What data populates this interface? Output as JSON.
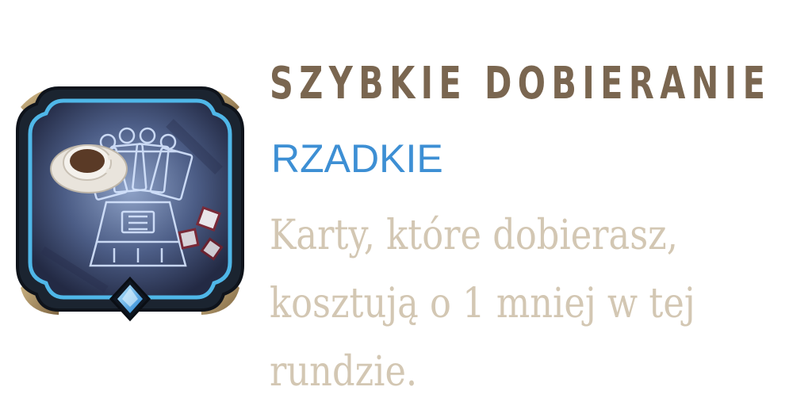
{
  "card": {
    "title": "SZYBKIE DOBIERANIE",
    "rarity": "RZADKIE",
    "description": "Karty, które dobierasz, kosztują o 1 mniej w tej rundzie.",
    "icon": "card-draw-blueprint-icon",
    "rarity_gem_icon": "blue-diamond-gem-icon"
  },
  "colors": {
    "title": "#7a6650",
    "rarity": "#3d8fd4",
    "description": "#d3c7b3",
    "frame_gold": "#b59a6e",
    "frame_dark": "#1b2430",
    "frame_glow": "#4fb7e8"
  }
}
